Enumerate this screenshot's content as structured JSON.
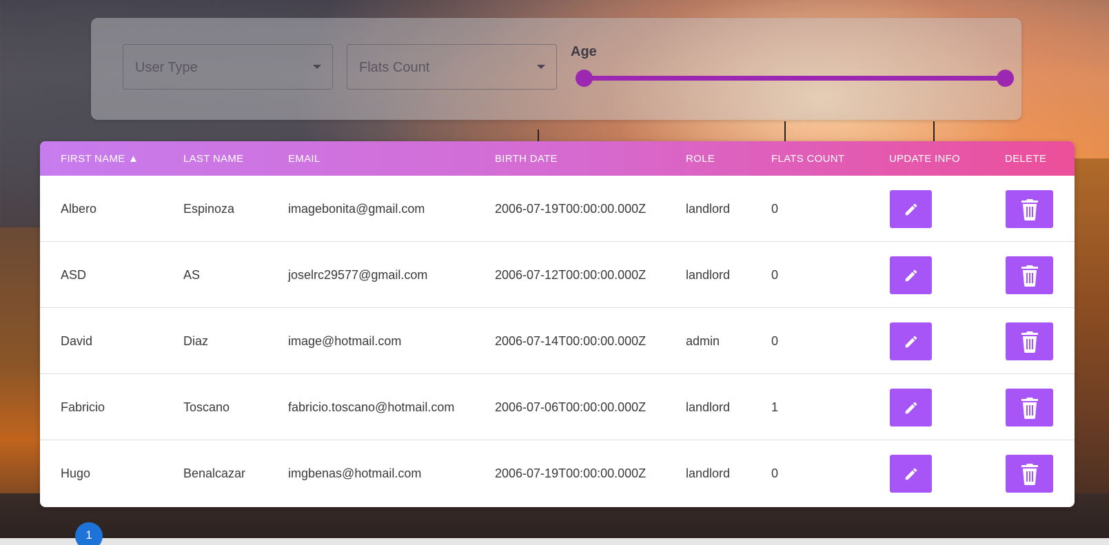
{
  "filters": {
    "user_type_label": "User Type",
    "flats_count_label": "Flats Count",
    "age_label": "Age",
    "age_range_fraction": [
      0,
      1
    ]
  },
  "table": {
    "headers": {
      "first_name": "FIRST NAME ▲",
      "last_name": "LAST NAME",
      "email": "EMAIL",
      "birth_date": "BIRTH DATE",
      "role": "ROLE",
      "flats_count": "FLATS COUNT",
      "update_info": "UPDATE INFO",
      "delete": "DELETE"
    },
    "rows": [
      {
        "first_name": "Albero",
        "last_name": "Espinoza",
        "email": "imagebonita@gmail.com",
        "birth_date": "2006-07-19T00:00:00.000Z",
        "role": "landlord",
        "flats_count": "0"
      },
      {
        "first_name": "ASD",
        "last_name": "AS",
        "email": "joselrc29577@gmail.com",
        "birth_date": "2006-07-12T00:00:00.000Z",
        "role": "landlord",
        "flats_count": "0"
      },
      {
        "first_name": "David",
        "last_name": "Diaz",
        "email": "image@hotmail.com",
        "birth_date": "2006-07-14T00:00:00.000Z",
        "role": "admin",
        "flats_count": "0"
      },
      {
        "first_name": "Fabricio",
        "last_name": "Toscano",
        "email": "fabricio.toscano@hotmail.com",
        "birth_date": "2006-07-06T00:00:00.000Z",
        "role": "landlord",
        "flats_count": "1"
      },
      {
        "first_name": "Hugo",
        "last_name": "Benalcazar",
        "email": "imgbenas@hotmail.com",
        "birth_date": "2006-07-19T00:00:00.000Z",
        "role": "landlord",
        "flats_count": "0"
      }
    ]
  },
  "pagination": {
    "current_page": "1"
  },
  "icons": {
    "update": "pencil-icon",
    "delete": "trash-icon",
    "select_caret": "caret-down-icon"
  },
  "colors": {
    "accent": "#a855f7",
    "slider": "#9c27b0",
    "header_start": "#c77cee",
    "header_end": "#ec4f9a",
    "page_button": "#1e73d8"
  }
}
